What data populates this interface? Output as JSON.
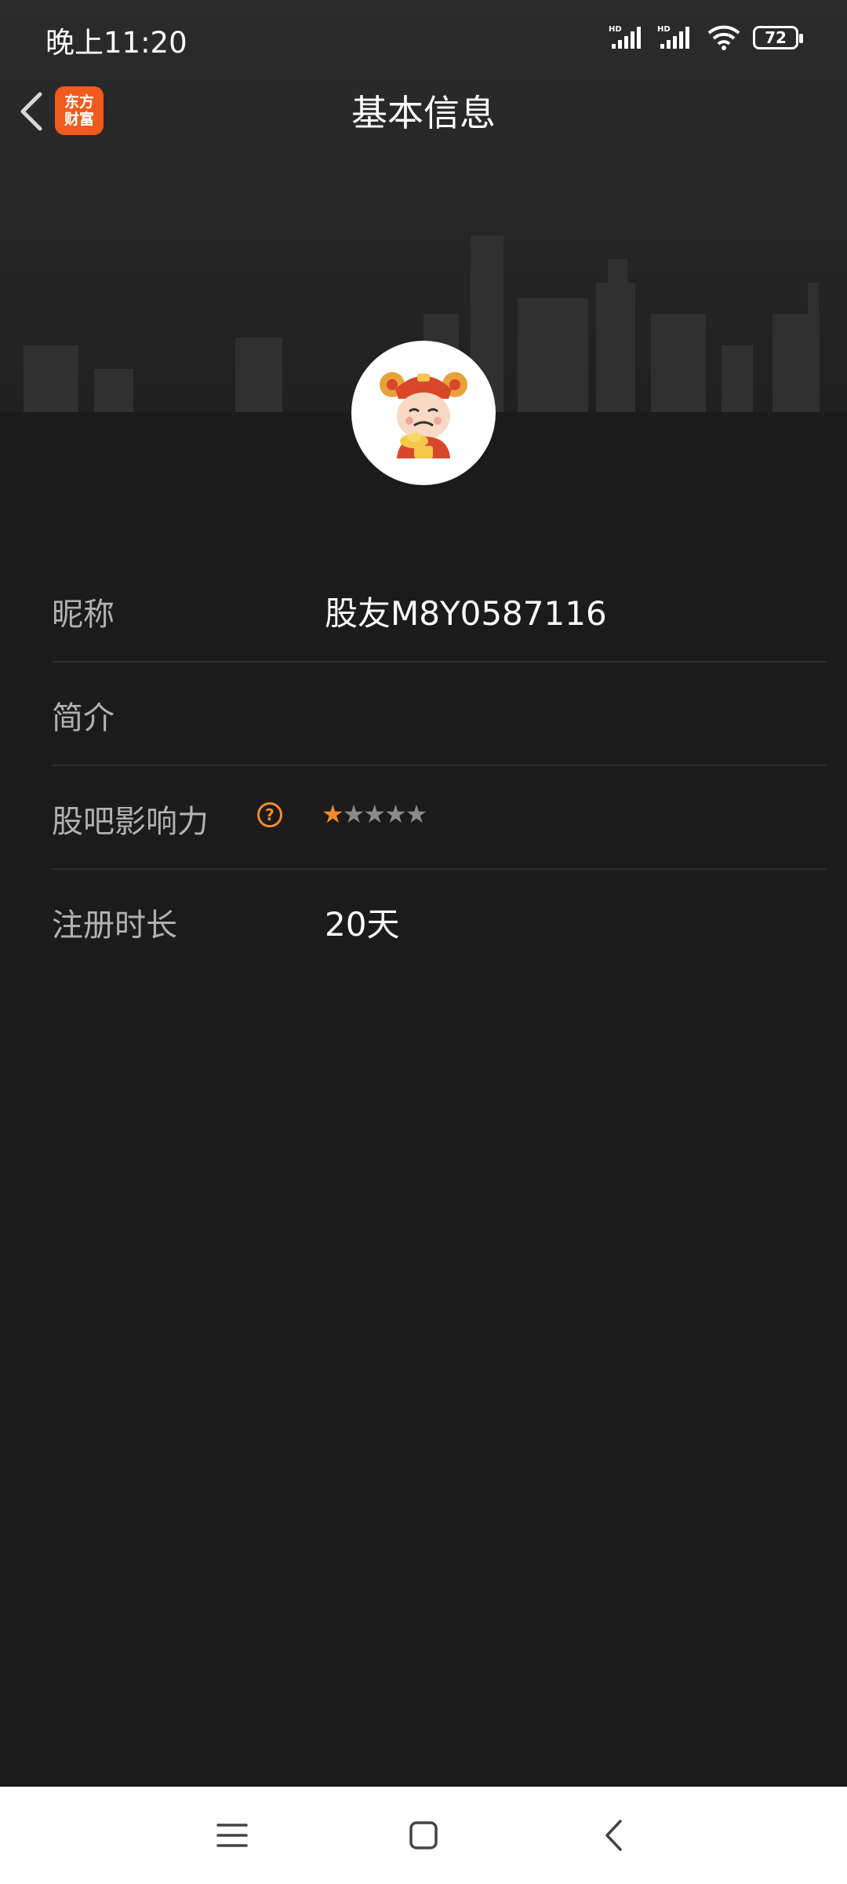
{
  "status_bar": {
    "time": "晚上11:20",
    "signal_label_1": "HD",
    "signal_label_2": "HD",
    "battery_level": "72",
    "icons": [
      "hd-signal-icon",
      "hd-signal-icon",
      "wifi-icon",
      "battery-icon"
    ]
  },
  "header": {
    "title": "基本信息",
    "app_badge_line1": "东方",
    "app_badge_line2": "财富",
    "back_icon": "chevron-left-icon"
  },
  "profile": {
    "avatar_icon": "god-of-wealth-avatar"
  },
  "rows": [
    {
      "label": "昵称",
      "value": "股友M8Y0587116"
    },
    {
      "label": "简介",
      "value": ""
    },
    {
      "label": "股吧影响力",
      "help_icon": "question-circle-icon",
      "rating": 1,
      "rating_max": 5,
      "star_on": "★",
      "stars_off": "★★★★"
    },
    {
      "label": "注册时长",
      "value": "20天"
    }
  ],
  "system_nav": {
    "icons": [
      "menu-icon",
      "home-icon",
      "back-icon"
    ]
  },
  "colors": {
    "background": "#1b1b1b",
    "accent": "#f28b2b",
    "badge": "#f25a1e",
    "label": "#b1b1b1",
    "divider": "#2e2e2e"
  }
}
